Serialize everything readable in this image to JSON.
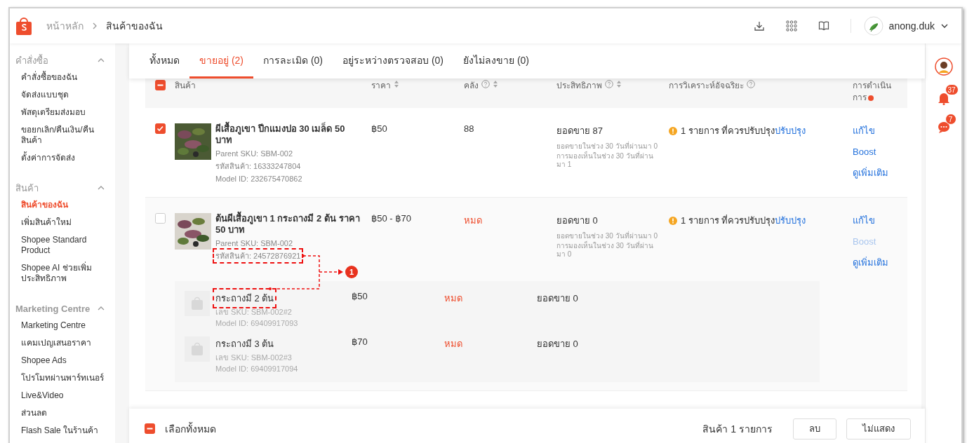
{
  "header": {
    "breadcrumb": [
      {
        "label": "หน้าหลัก",
        "current": false
      },
      {
        "label": "สินค้าของฉัน",
        "current": true
      }
    ],
    "user": {
      "name": "anong.duk"
    }
  },
  "sidebar": {
    "sections": [
      {
        "title": "คำสั่งซื้อ",
        "expanded": true,
        "items": [
          {
            "label": "คำสั่งซื้อของฉัน",
            "selected": false
          },
          {
            "label": "จัดส่งแบบชุด",
            "selected": false
          },
          {
            "label": "พัสดุเตรียมส่งมอบ",
            "selected": false
          },
          {
            "label": "ขอยกเลิก/คืนเงิน/คืนสินค้า",
            "selected": false
          },
          {
            "label": "ตั้งค่าการจัดส่ง",
            "selected": false
          }
        ]
      },
      {
        "title": "สินค้า",
        "expanded": true,
        "items": [
          {
            "label": "สินค้าของฉัน",
            "selected": true
          },
          {
            "label": "เพิ่มสินค้าใหม่",
            "selected": false
          },
          {
            "label": "Shopee Standard Product",
            "selected": false
          },
          {
            "label": "Shopee AI ช่วยเพิ่มประสิทธิภาพ",
            "selected": false
          }
        ]
      },
      {
        "title": "Marketing Centre",
        "expanded": true,
        "items": [
          {
            "label": "Marketing Centre",
            "selected": false
          },
          {
            "label": "แคมเปญเสนอราคา",
            "selected": false
          },
          {
            "label": "Shopee Ads",
            "selected": false
          },
          {
            "label": "โปรโมทผ่านพาร์ทเนอร์",
            "selected": false
          },
          {
            "label": "Live&Video",
            "selected": false
          },
          {
            "label": "ส่วนลด",
            "selected": false
          },
          {
            "label": "Flash Sale ในร้านค้า",
            "selected": false
          }
        ]
      }
    ]
  },
  "tabs": [
    {
      "label": "ทั้งหมด",
      "selected": false
    },
    {
      "label": "ขายอยู่ (2)",
      "selected": true
    },
    {
      "label": "การละเมิด (0)",
      "selected": false
    },
    {
      "label": "อยู่ระหว่างตรวจสอบ (0)",
      "selected": false
    },
    {
      "label": "ยังไม่ลงขาย (0)",
      "selected": false
    }
  ],
  "table": {
    "select_all_partial": true,
    "columns": [
      {
        "label": "สินค้า"
      },
      {
        "label": "ราคา",
        "sortable": true
      },
      {
        "label": "คลัง",
        "help": true,
        "sortable": true
      },
      {
        "label": "ประสิทธิภาพ",
        "help": true,
        "sortable": true
      },
      {
        "label": "การวิเคราะห์อัจฉริยะ",
        "help": true
      },
      {
        "label": "การดำเนินการ",
        "alert": true
      }
    ],
    "products": [
      {
        "checked": true,
        "name": "ผีเสื้อภูเขา ปีกแมงปอ 30 เมล็ด 50 บาท",
        "lines": [
          {
            "text": "Parent SKU: SBM-002"
          },
          {
            "text": "รหัสสินค้า: 16333247804"
          },
          {
            "text": "Model ID: 232675470862"
          }
        ],
        "price": "฿50",
        "stock": "88",
        "sold_out": false,
        "sales": "ยอดขาย 87",
        "sales_30d": "ยอดขายในช่วง 30 วันที่ผ่านมา 0",
        "views_30d": "การมองเห็นในช่วง 30 วันที่ผ่านมา 1",
        "issue": "1 รายการ ที่ควรปรับปรุง",
        "issue_link": "ปรับปรุง",
        "actions": [
          {
            "label": "แก้ไข",
            "disabled": false
          },
          {
            "label": "Boost",
            "disabled": false
          },
          {
            "label": "ดูเพิ่มเติม",
            "disabled": false
          }
        ]
      },
      {
        "checked": false,
        "name": "ต้นผีเสื้อภูเขา 1 กระถางมี 2 ต้น ราคา 50 บาท",
        "lines": [
          {
            "text": "Parent SKU: SBM-002"
          },
          {
            "text": "รหัสสินค้า: 24572876921",
            "highlighted": true
          }
        ],
        "price": "฿50 - ฿70",
        "stock": "หมด",
        "sold_out": true,
        "sales": "ยอดขาย 0",
        "sales_30d": "ยอดขายในช่วง 30 วันที่ผ่านมา 0",
        "views_30d": "การมองเห็นในช่วง 30 วันที่ผ่านมา 0",
        "issue": "1 รายการ ที่ควรปรับปรุง",
        "issue_link": "ปรับปรุง",
        "actions": [
          {
            "label": "แก้ไข",
            "disabled": false
          },
          {
            "label": "Boost",
            "disabled": true
          },
          {
            "label": "ดูเพิ่มเติม",
            "disabled": false
          }
        ],
        "variations": [
          {
            "name": "กระถางมี 2 ต้น",
            "highlighted": true,
            "sku": "เลข SKU: SBM-002#2",
            "model_id": "Model ID: 69409917093",
            "price": "฿50",
            "stock": "หมด",
            "sold_out": true,
            "sales": "ยอดขาย 0"
          },
          {
            "name": "กระถางมี 3 ต้น",
            "highlighted": false,
            "sku": "เลข SKU: SBM-002#3",
            "model_id": "Model ID: 69409917094",
            "price": "฿70",
            "stock": "หมด",
            "sold_out": true,
            "sales": "ยอดขาย 0"
          }
        ]
      }
    ]
  },
  "annotation": {
    "number": "1"
  },
  "footer": {
    "select_all_partial": true,
    "select_all_label": "เลือกทั้งหมด",
    "count": "สินค้า 1 รายการ",
    "buttons": [
      "ลบ",
      "ไม่แสดง"
    ]
  },
  "rail": {
    "notifications": "37",
    "messages": "7"
  }
}
